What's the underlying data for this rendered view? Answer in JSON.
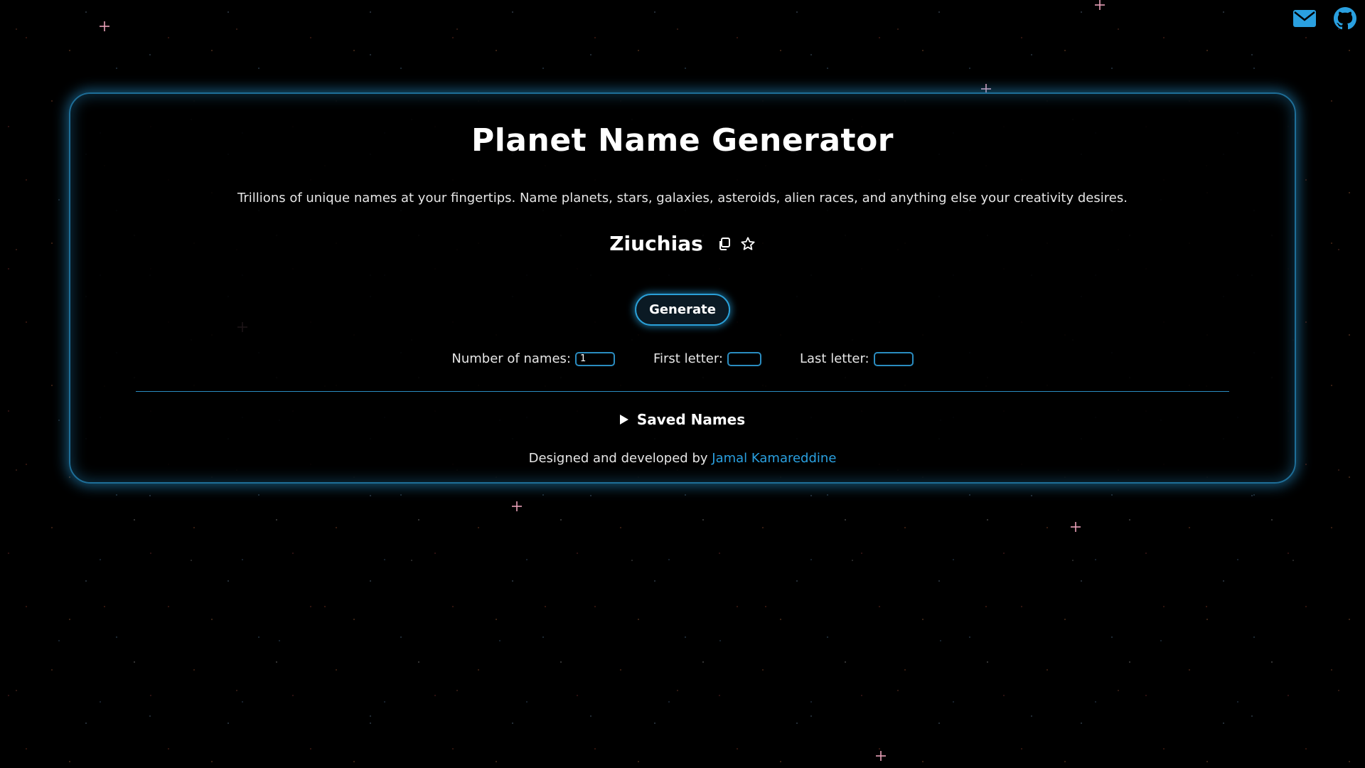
{
  "header": {
    "title": "Planet Name Generator",
    "description": "Trillions of unique names at your fingertips. Name planets, stars, galaxies, asteroids, alien races, and anything else your creativity desires."
  },
  "generated": {
    "name": "Ziuchias",
    "copy_icon": "copy-icon",
    "favorite_icon": "star-icon"
  },
  "actions": {
    "generate_label": "Generate"
  },
  "options": {
    "number_label": "Number of names:",
    "number_value": "1",
    "first_letter_label": "First letter:",
    "first_letter_value": "",
    "last_letter_label": "Last letter:",
    "last_letter_value": ""
  },
  "saved": {
    "label": "Saved Names"
  },
  "footer": {
    "prefix": "Designed and developed by",
    "author": "Jamal Kamareddine"
  },
  "top_links": {
    "mail_icon": "mail-icon",
    "github_icon": "github-icon"
  },
  "colors": {
    "accent": "#2aa0e0",
    "border_glow": "#1e6e98",
    "background": "#000000"
  }
}
